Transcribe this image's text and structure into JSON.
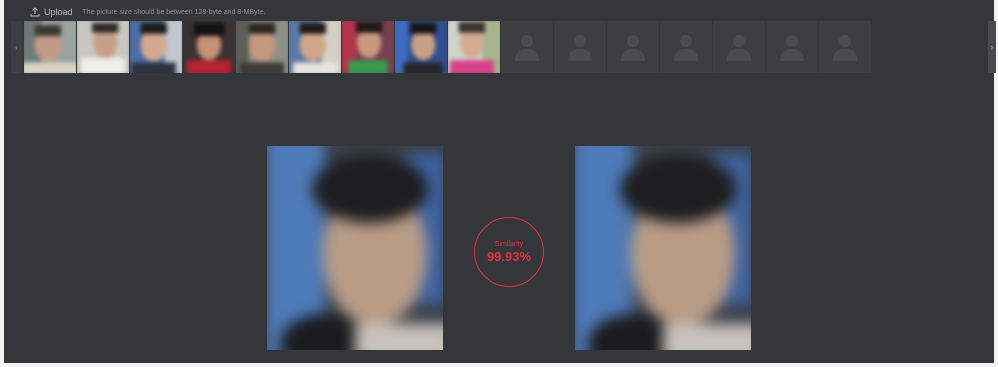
{
  "upload": {
    "label": "Upload",
    "icon": "upload-icon",
    "hint": "The picture size should be between 128-byte and 8-MByte."
  },
  "gallery": {
    "photo_count": 9,
    "placeholder_count": 7,
    "placeholder_icon": "person-silhouette-icon",
    "prev_icon": "chevron-left-icon",
    "next_icon": "chevron-right-icon"
  },
  "comparison": {
    "similarity_label": "Similarity",
    "similarity_value": "99.93%"
  },
  "colors": {
    "background": "#34363a",
    "accent": "#e0333f",
    "placeholder_tile": "#3c3e42"
  }
}
